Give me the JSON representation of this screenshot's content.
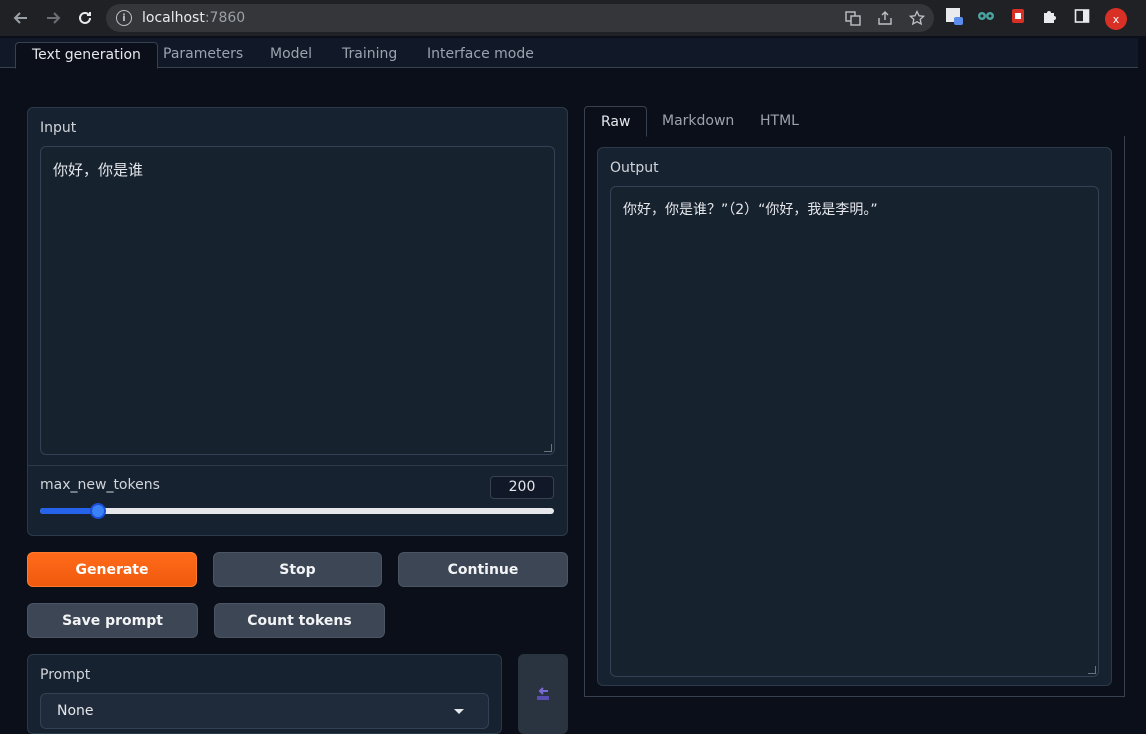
{
  "browser": {
    "url_host": "localhost",
    "url_port": ":7860",
    "avatar_letter": "x"
  },
  "top_tabs": [
    {
      "label": "Text generation"
    },
    {
      "label": "Parameters"
    },
    {
      "label": "Model"
    },
    {
      "label": "Training"
    },
    {
      "label": "Interface mode"
    }
  ],
  "input": {
    "label": "Input",
    "value": "你好，你是谁"
  },
  "max_new_tokens": {
    "label": "max_new_tokens",
    "value": "200"
  },
  "buttons": {
    "generate": "Generate",
    "stop": "Stop",
    "continue": "Continue",
    "save_prompt": "Save prompt",
    "count_tokens": "Count tokens"
  },
  "prompt": {
    "label": "Prompt",
    "selected": "None"
  },
  "output_tabs": [
    {
      "label": "Raw"
    },
    {
      "label": "Markdown"
    },
    {
      "label": "HTML"
    }
  ],
  "output": {
    "label": "Output",
    "value": "你好，你是谁？”（2）“你好，我是李明。”"
  },
  "colors": {
    "accent_orange": "#ff6a1a",
    "slider_blue": "#2563eb",
    "panel_bg": "#172230",
    "page_bg": "#0b0f19"
  }
}
